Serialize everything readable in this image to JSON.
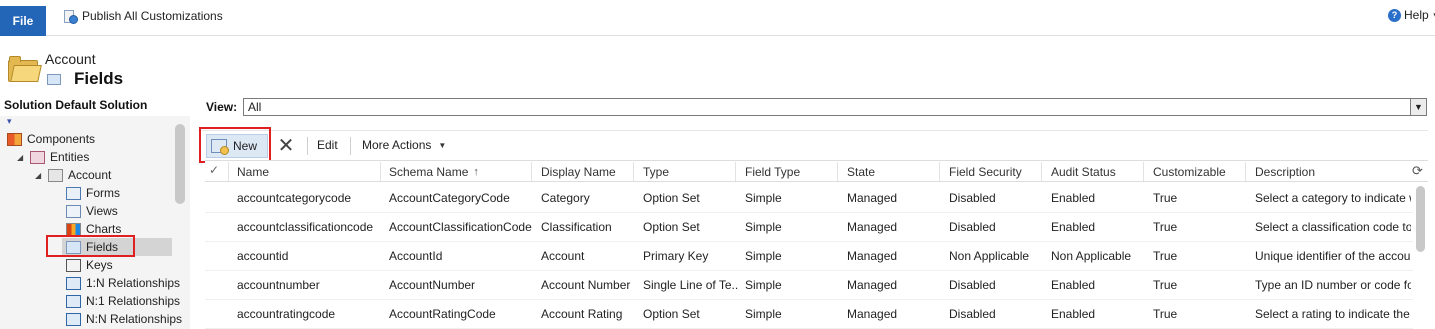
{
  "ribbon": {
    "file_label": "File",
    "publish_label": "Publish All Customizations",
    "help_label": "Help"
  },
  "header": {
    "entity_name": "Account",
    "page_title": "Fields"
  },
  "solution": {
    "label": "Solution Default Solution"
  },
  "nav": {
    "components": "Components",
    "entities": "Entities",
    "account": "Account",
    "forms": "Forms",
    "views": "Views",
    "charts": "Charts",
    "fields": "Fields",
    "keys": "Keys",
    "rel_1n": "1:N Relationships",
    "rel_n1": "N:1 Relationships",
    "rel_nn": "N:N Relationships"
  },
  "view": {
    "label": "View:",
    "selected": "All"
  },
  "toolbar": {
    "new_label": "New",
    "edit_label": "Edit",
    "more_actions_label": "More Actions"
  },
  "grid": {
    "columns": [
      "Name",
      "Schema Name",
      "Display Name",
      "Type",
      "Field Type",
      "State",
      "Field Security",
      "Audit Status",
      "Customizable",
      "Description"
    ],
    "rows": [
      [
        "accountcategorycode",
        "AccountCategoryCode",
        "Category",
        "Option Set",
        "Simple",
        "Managed",
        "Disabled",
        "Enabled",
        "True",
        "Select a category to indicate whe"
      ],
      [
        "accountclassificationcode",
        "AccountClassificationCode",
        "Classification",
        "Option Set",
        "Simple",
        "Managed",
        "Disabled",
        "Enabled",
        "True",
        "Select a classification code to inc"
      ],
      [
        "accountid",
        "AccountId",
        "Account",
        "Primary Key",
        "Simple",
        "Managed",
        "Non Applicable",
        "Non Applicable",
        "True",
        "Unique identifier of the account."
      ],
      [
        "accountnumber",
        "AccountNumber",
        "Account Number",
        "Single Line of Te...",
        "Simple",
        "Managed",
        "Disabled",
        "Enabled",
        "True",
        "Type an ID number or code for t"
      ],
      [
        "accountratingcode",
        "AccountRatingCode",
        "Account Rating",
        "Option Set",
        "Simple",
        "Managed",
        "Disabled",
        "Enabled",
        "True",
        "Select a rating to indicate the va"
      ]
    ]
  },
  "colors": {
    "file_button": "#2366b8",
    "highlight": "#e02020",
    "selection": "#d4d4d4"
  },
  "icons": [
    "publish-icon",
    "help-icon",
    "folder-icon",
    "fields-icon",
    "components-icon",
    "entities-icon",
    "forms-icon",
    "views-icon",
    "charts-icon",
    "keys-icon",
    "relationship-icon",
    "new-record-icon",
    "delete-icon",
    "sort-ascending-icon",
    "refresh-icon"
  ]
}
